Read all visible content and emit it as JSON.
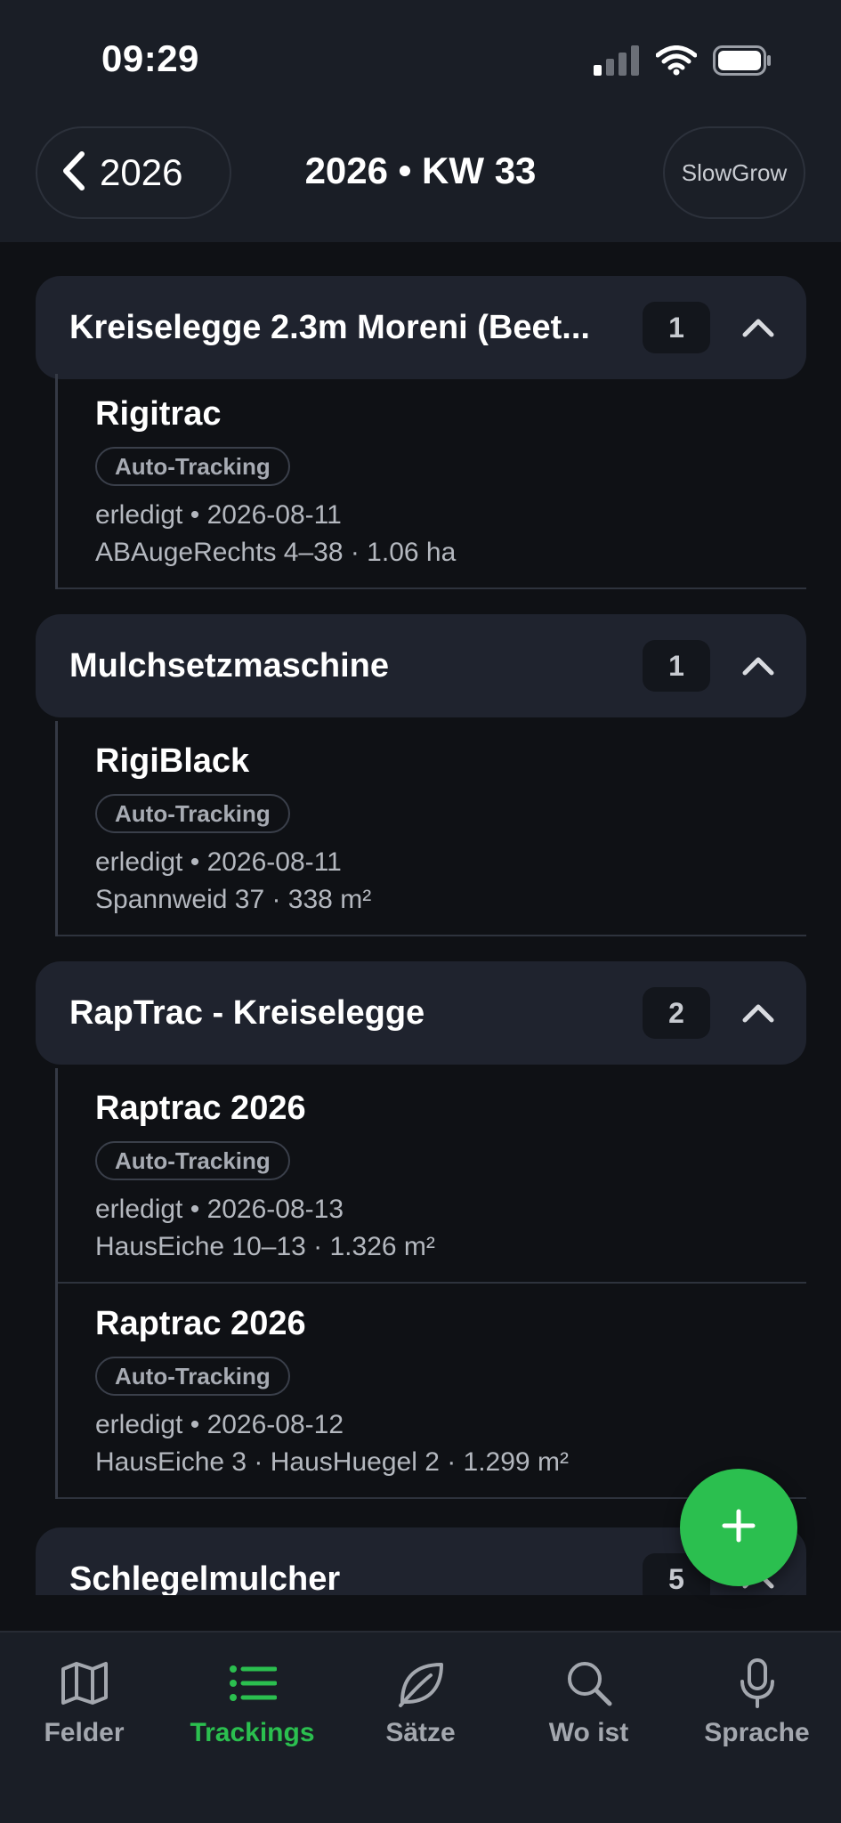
{
  "status_bar": {
    "time": "09:29",
    "icons": [
      "cellular-signal-icon",
      "wifi-icon",
      "battery-icon"
    ]
  },
  "nav": {
    "back_label": "2026",
    "title": "2026 • KW 33",
    "right_button": "SlowGrow"
  },
  "colors": {
    "accent": "#2bbf4f",
    "background": "#0f1115",
    "card": "#1f232e"
  },
  "groups": [
    {
      "title": "Kreiselegge 2.3m Moreni (Beet...",
      "count": "1",
      "expanded": true,
      "items": [
        {
          "title": "Rigitrac",
          "badge": "Auto-Tracking",
          "line1": "erledigt • 2026-08-11",
          "line2": "ABAugeRechts 4–38 · 1.06 ha"
        }
      ]
    },
    {
      "title": "Mulchsetzmaschine",
      "count": "1",
      "expanded": true,
      "items": [
        {
          "title": "RigiBlack",
          "badge": "Auto-Tracking",
          "line1": "erledigt • 2026-08-11",
          "line2": "Spannweid 37 · 338 m²"
        }
      ]
    },
    {
      "title": "RapTrac - Kreiselegge",
      "count": "2",
      "expanded": true,
      "items": [
        {
          "title": "Raptrac 2026",
          "badge": "Auto-Tracking",
          "line1": "erledigt • 2026-08-13",
          "line2": "HausEiche 10–13 · 1.326 m²"
        },
        {
          "title": "Raptrac 2026",
          "badge": "Auto-Tracking",
          "line1": "erledigt • 2026-08-12",
          "line2": "HausEiche 3 · HausHuegel 2 · 1.299 m²"
        }
      ]
    },
    {
      "title": "Schlegelmulcher",
      "count": "5",
      "expanded": true,
      "items": []
    }
  ],
  "fab": {
    "icon": "plus-icon"
  },
  "tabs": [
    {
      "label": "Felder",
      "icon": "map-icon",
      "active": false
    },
    {
      "label": "Trackings",
      "icon": "list-icon",
      "active": true
    },
    {
      "label": "Sätze",
      "icon": "leaf-icon",
      "active": false
    },
    {
      "label": "Wo ist",
      "icon": "search-icon",
      "active": false
    },
    {
      "label": "Sprache",
      "icon": "microphone-icon",
      "active": false
    }
  ]
}
